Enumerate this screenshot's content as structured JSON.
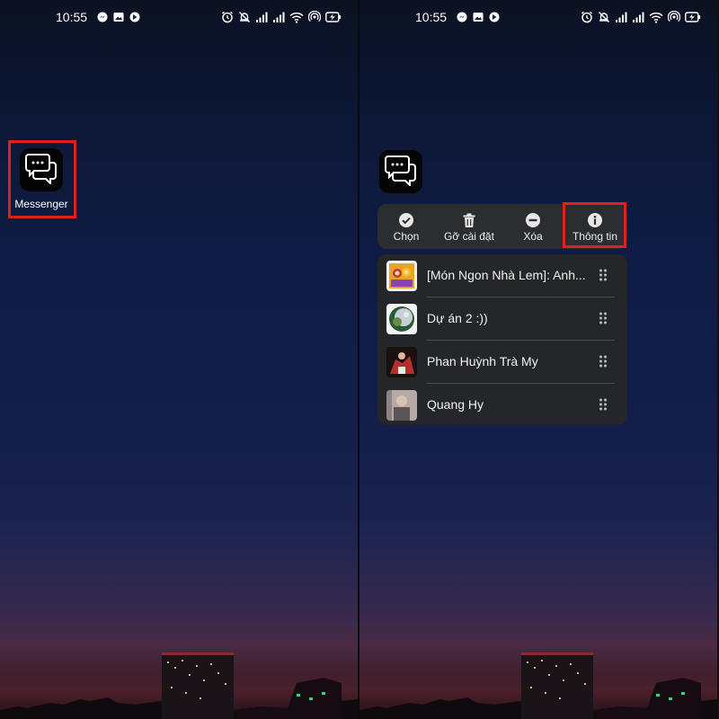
{
  "status_bar": {
    "time": "10:55",
    "notification_icons": [
      "messenger-icon",
      "image-icon",
      "app-icon"
    ],
    "system_icons": [
      "alarm-icon",
      "mute-icon",
      "signal-icon",
      "signal-icon",
      "wifi-icon",
      "hotspot-icon",
      "battery-charging-icon"
    ]
  },
  "left_screen": {
    "app": {
      "label": "Messenger",
      "icon": "messenger-chat-icon"
    }
  },
  "right_screen": {
    "app": {
      "icon": "messenger-chat-icon"
    },
    "actions": [
      {
        "label": "Chọn",
        "icon": "check-circle-icon"
      },
      {
        "label": "Gỡ cài đặt",
        "icon": "trash-icon"
      },
      {
        "label": "Xóa",
        "icon": "minus-circle-icon"
      },
      {
        "label": "Thông tin",
        "icon": "info-icon"
      }
    ],
    "shortcuts": [
      {
        "label": "[Món Ngon Nhà Lem]: Anh..."
      },
      {
        "label": "Dự án 2 :))"
      },
      {
        "label": "Phan Huỳnh Trà My"
      },
      {
        "label": "Quang Hy"
      }
    ]
  },
  "colors": {
    "highlight": "#e0201e",
    "menu_background": "#2e2e30",
    "sky_top": "#0b1222",
    "sky_horizon": "#4a2a44"
  }
}
